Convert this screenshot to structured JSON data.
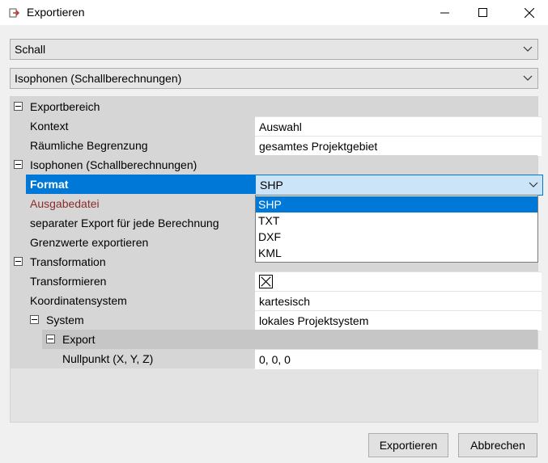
{
  "window": {
    "title": "Exportieren",
    "minimize": "—",
    "maximize": "☐",
    "close": "✕"
  },
  "combos": {
    "category": "Schall",
    "type": "Isophonen (Schallberechnungen)"
  },
  "grid": {
    "sec1": "Exportbereich",
    "kontext_label": "Kontext",
    "kontext_value": "Auswahl",
    "begrenzung_label": "Räumliche Begrenzung",
    "begrenzung_value": "gesamtes Projektgebiet",
    "sec2": "Isophonen (Schallberechnungen)",
    "format_label": "Format",
    "format_value": "SHP",
    "ausgabe_label": "Ausgabedatei",
    "separat_label": "separater Export für jede Berechnung",
    "grenz_label": "Grenzwerte exportieren",
    "sec3": "Transformation",
    "transform_label": "Transformieren",
    "koord_label": "Koordinatensystem",
    "koord_value": "kartesisch",
    "system_label": "System",
    "system_value": "lokales Projektsystem",
    "export_label": "Export",
    "null_label": "Nullpunkt (X, Y, Z)",
    "null_value": "0, 0, 0"
  },
  "dropdown": {
    "options": [
      "SHP",
      "TXT",
      "DXF",
      "KML"
    ],
    "selected": "SHP"
  },
  "buttons": {
    "export": "Exportieren",
    "cancel": "Abbrechen"
  },
  "colors": {
    "selection": "#0078d7",
    "error_label": "#8b2b2b",
    "field_bg": "#ffffff"
  }
}
